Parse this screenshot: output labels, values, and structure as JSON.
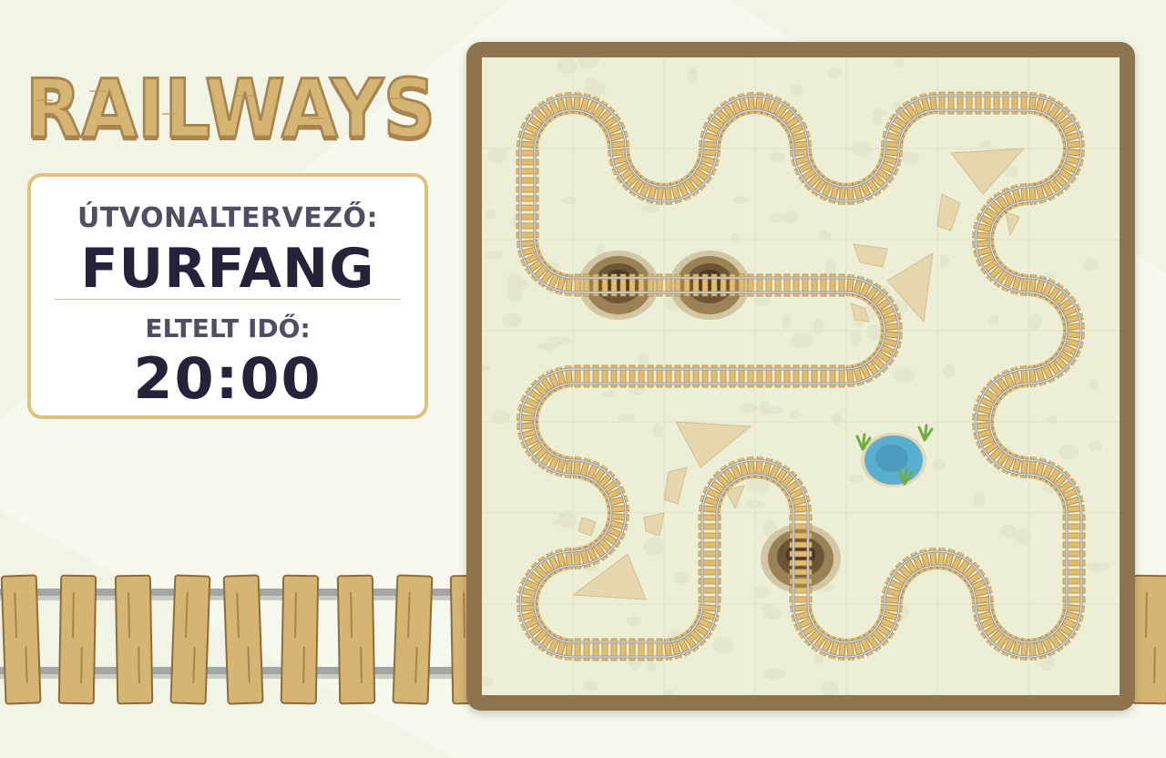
{
  "game": {
    "logo_text": "RAILWAYS",
    "planner_label": "ÚTVONALTERVEZŐ:",
    "planner_name": "FURFANG",
    "time_label": "ELTELT IDŐ:",
    "time_value": "20:00"
  },
  "board": {
    "rows": 7,
    "cols": 7,
    "tiles": [
      [
        "curve-se",
        "curve-sw",
        "curve-se",
        "curve-sw",
        "curve-se",
        "straight-h",
        "curve-sw"
      ],
      [
        "straight-v",
        "curve-ne",
        "curve-nw",
        "curve-ne",
        "curve-nw",
        "curve-se",
        "curve-nw"
      ],
      [
        "curve-ne",
        "mountain-straight-h",
        "mountain-straight-h",
        "straight-h",
        "curve-sw",
        "curve-ne",
        "curve-sw"
      ],
      [
        "curve-se",
        "straight-h",
        "straight-h",
        "straight-h",
        "curve-nw",
        "curve-se",
        "curve-nw"
      ],
      [
        "curve-ne",
        "curve-sw",
        "curve-se",
        "curve-sw",
        "oasis",
        "curve-ne",
        "curve-sw"
      ],
      [
        "curve-se",
        "curve-nw",
        "straight-v",
        "mountain-straight-v",
        "curve-se",
        "curve-sw",
        "straight-v"
      ],
      [
        "curve-ne",
        "straight-h",
        "curve-nw",
        "curve-ne",
        "curve-nw",
        "curve-ne",
        "curve-nw"
      ]
    ]
  },
  "colors": {
    "background": "#f7f8ee",
    "board_frame": "#8e734f",
    "board_ground": "#eceed6",
    "logo_fill": "#d6b574",
    "logo_outline": "#a88550",
    "sleeper": "#e2bd70",
    "rail": "#9c9c9c",
    "mountain": "#6b5435",
    "oasis_water": "#5aaed0",
    "text_dark": "#24233a"
  }
}
